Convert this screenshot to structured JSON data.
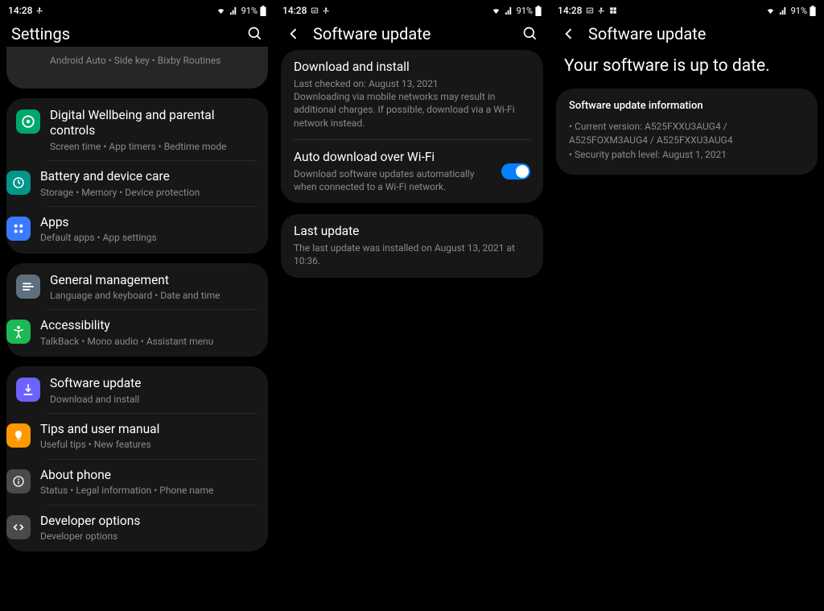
{
  "status": {
    "time": "14:28",
    "battery": "91%"
  },
  "headers": {
    "settings": "Settings",
    "software_update": "Software update"
  },
  "screen1": {
    "group0": {
      "item0": {
        "title_trim": "",
        "sub": "Android Auto  •  Side key  •  Bixby Routines"
      }
    },
    "group1": {
      "item0": {
        "title": "Digital Wellbeing and parental controls",
        "sub": "Screen time  •  App timers  •  Bedtime mode"
      },
      "item1": {
        "title": "Battery and device care",
        "sub": "Storage  •  Memory  •  Device protection"
      },
      "item2": {
        "title": "Apps",
        "sub": "Default apps  •  App settings"
      }
    },
    "group2": {
      "item0": {
        "title": "General management",
        "sub": "Language and keyboard  •  Date and time"
      },
      "item1": {
        "title": "Accessibility",
        "sub": "TalkBack  •  Mono audio  •  Assistant menu"
      }
    },
    "group3": {
      "item0": {
        "title": "Software update",
        "sub": "Download and install"
      },
      "item1": {
        "title": "Tips and user manual",
        "sub": "Useful tips  •  New features"
      },
      "item2": {
        "title": "About phone",
        "sub": "Status  •  Legal information  •  Phone name"
      },
      "item3": {
        "title": "Developer options",
        "sub": "Developer options"
      }
    }
  },
  "screen2": {
    "card1": {
      "item0": {
        "title": "Download and install",
        "sub": "Last checked on: August 13, 2021\nDownloading via mobile networks may result in additional charges. If possible, download via a Wi-Fi network instead."
      },
      "item1": {
        "title": "Auto download over Wi-Fi",
        "sub": "Download software updates automatically when connected to a Wi-Fi network.",
        "toggle": true
      }
    },
    "card2": {
      "item0": {
        "title": "Last update",
        "sub": "The last update was installed on August 13, 2021 at 10:36."
      }
    }
  },
  "screen3": {
    "hero": "Your software is up to date.",
    "info_heading": "Software update information",
    "lines": {
      "l0": "• Current version: A525FXXU3AUG4 / A525FOXM3AUG4 / A525FXXU3AUG4",
      "l1": "• Security patch level: August 1, 2021"
    }
  }
}
